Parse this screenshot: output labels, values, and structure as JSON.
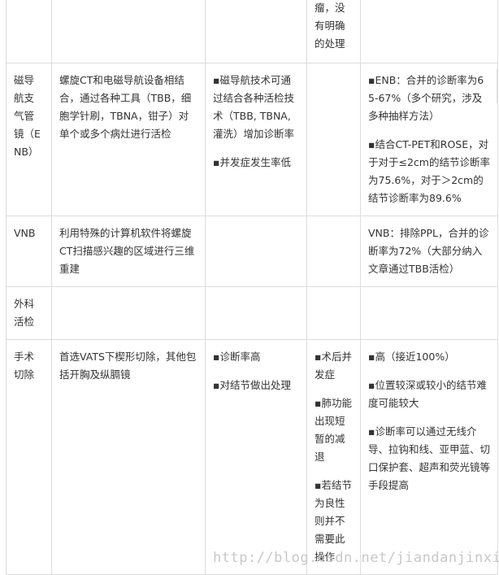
{
  "table": {
    "rows": [
      {
        "method": "",
        "description": "",
        "advantages": [],
        "disadvantages": [
          "瘤，没有明确的处理"
        ],
        "diagnostic_rate": []
      },
      {
        "method": "磁导航支气管镜（ENB）",
        "description": "螺旋CT和电磁导航设备相结合，通过各种工具（TBB，细胞学针刷，TBNA，钳子）对单个或多个病灶进行活检",
        "advantages": [
          "▪磁导航技术可通过结合各种活检技术（TBB, TBNA, 灌洗）增加诊断率",
          "▪并发症发生率低"
        ],
        "disadvantages": [],
        "diagnostic_rate": [
          "▪ENB：合并的诊断率为65-67%（多个研究，涉及多种抽样方法）",
          "▪结合CT-PET和ROSE，对于对于≤2cm的结节诊断率为75.6%，对于＞2cm的结节诊断率为89.6%"
        ]
      },
      {
        "method": "VNB",
        "description": "利用特殊的计算机软件将螺旋CT扫描感兴趣的区域进行三维重建",
        "advantages": [],
        "disadvantages": [],
        "diagnostic_rate": [
          "VNB：排除PPL，合并的诊断率为72%（大部分纳入文章通过TBB活检）"
        ]
      },
      {
        "method": "外科活检",
        "description": "",
        "advantages": [],
        "disadvantages": [],
        "diagnostic_rate": []
      },
      {
        "method": "手术切除",
        "description": "首选VATS下楔形切除，其他包括开胸及纵膈镜",
        "advantages": [
          "▪诊断率高",
          "▪对结节做出处理"
        ],
        "disadvantages": [
          "▪术后并发症",
          "▪肺功能出现短暂的减退",
          "▪若结节为良性则并不需要此操作"
        ],
        "diagnostic_rate": [
          "▪高（接近100%）",
          "▪位置较深或较小的结节难度可能较大",
          "▪诊断率可以通过无线介导、拉钩和线、亚甲蓝、切口保护套、超声和荧光镜等手段提高"
        ]
      }
    ]
  },
  "watermark": "http://blog.csdn.net/jiandanjinxin"
}
